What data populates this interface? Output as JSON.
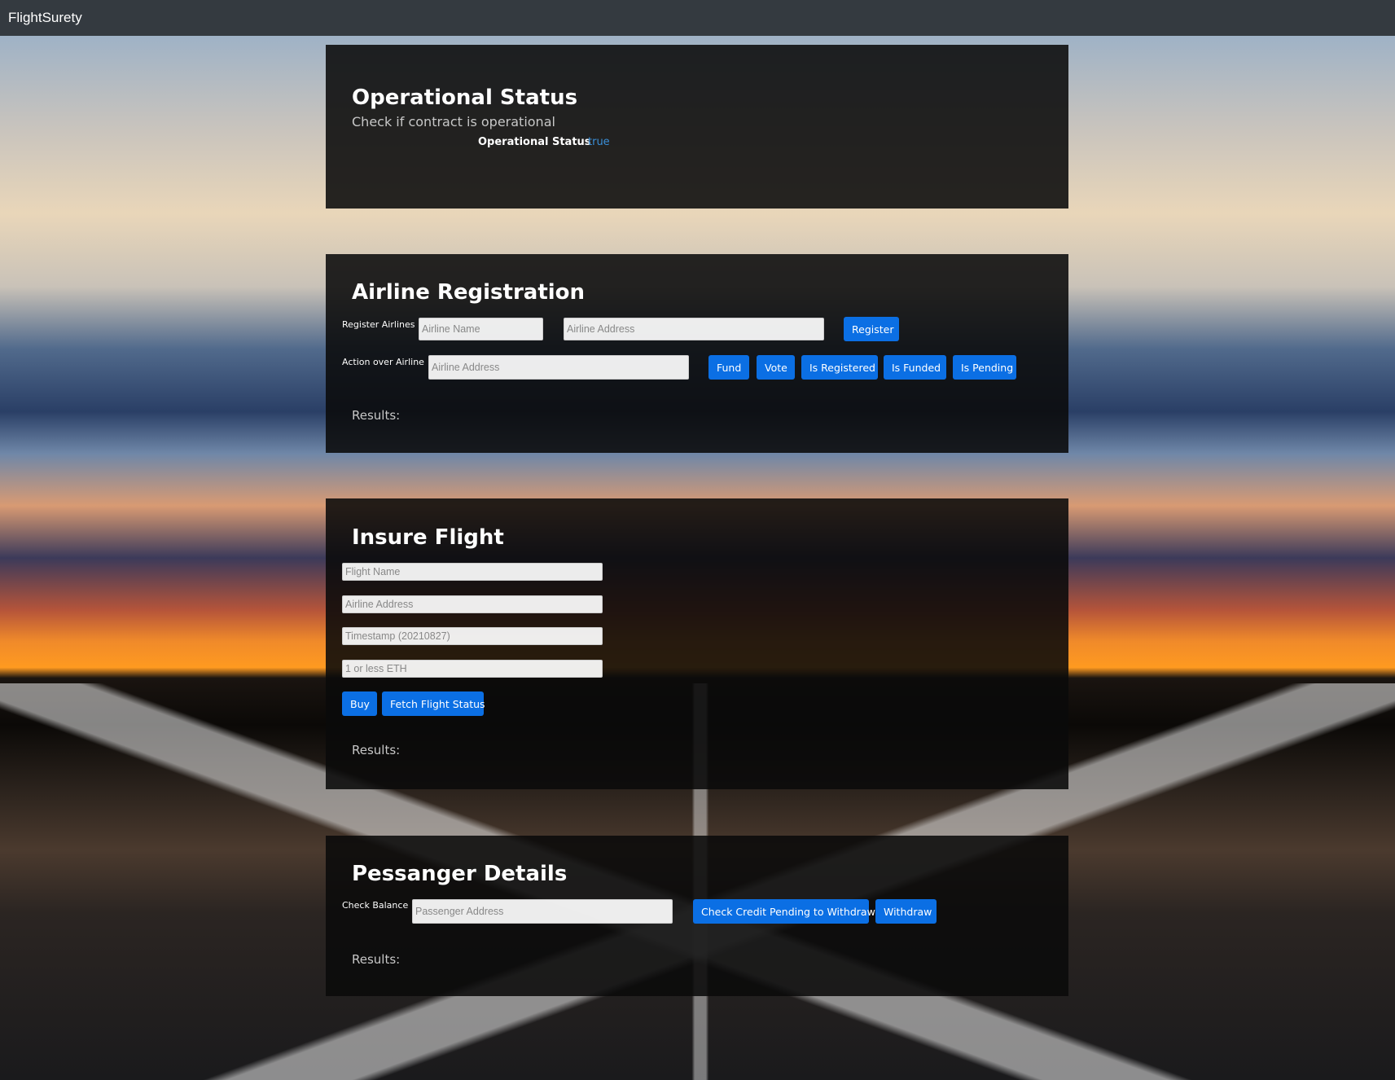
{
  "navbar": {
    "brand": "FlightSurety"
  },
  "operational": {
    "title": "Operational Status",
    "subtitle": "Check if contract is operational",
    "status_label": "Operational Status",
    "status_value": "true"
  },
  "airline_registration": {
    "title": "Airline Registration",
    "register_label": "Register Airlines",
    "airline_name_placeholder": "Airline Name",
    "airline_address_placeholder": "Airline Address",
    "register_button": "Register",
    "action_label": "Action over Airline",
    "action_address_placeholder": "Airline Address",
    "buttons": [
      "Fund",
      "Vote",
      "Is Registered",
      "Is Funded",
      "Is Pending"
    ],
    "results_label": "Results:"
  },
  "insure_flight": {
    "title": "Insure Flight",
    "flight_name_placeholder": "Flight Name",
    "airline_address_placeholder": "Airline Address",
    "timestamp_placeholder": "Timestamp (20210827)",
    "amount_placeholder": "1 or less ETH",
    "buy_button": "Buy",
    "fetch_button": "Fetch Flight Status",
    "results_label": "Results:"
  },
  "passenger": {
    "title": "Pessanger Details",
    "check_label": "Check Balance",
    "address_placeholder": "Passenger Address",
    "check_button": "Check Credit Pending to Withdraw",
    "withdraw_button": "Withdraw",
    "results_label": "Results:"
  },
  "colors": {
    "navbar": "#343a40",
    "button": "#0b6fe4",
    "status_value": "#3a8fd8"
  }
}
